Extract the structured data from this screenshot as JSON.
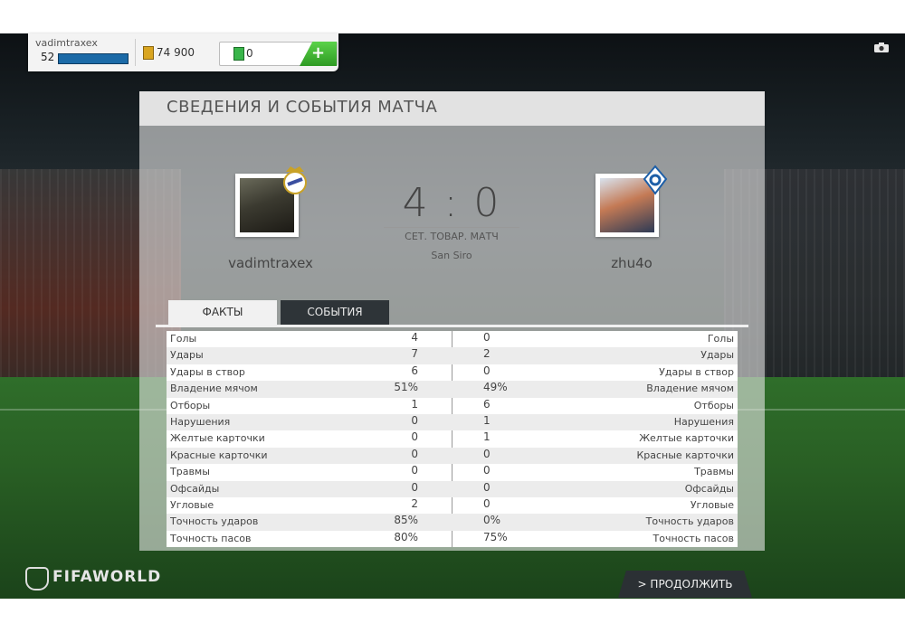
{
  "user": {
    "name": "vadimtraxex",
    "level": "52",
    "coins": "74 900",
    "points": "0",
    "add_label": "+"
  },
  "panel": {
    "title": "СВЕДЕНИЯ И СОБЫТИЯ МАТЧА"
  },
  "match": {
    "home_name": "vadimtraxex",
    "away_name": "zhu4o",
    "score": "4 : 0",
    "match_type": "СЕТ. ТОВАР. МАТЧ",
    "stadium": "San Siro"
  },
  "tabs": [
    {
      "label": "ФАКТЫ",
      "active": true
    },
    {
      "label": "СОБЫТИЯ",
      "active": false
    }
  ],
  "stats": [
    {
      "label": "Голы",
      "home": "4",
      "away": "0"
    },
    {
      "label": "Удары",
      "home": "7",
      "away": "2"
    },
    {
      "label": "Удары в створ",
      "home": "6",
      "away": "0"
    },
    {
      "label": "Владение мячом",
      "home": "51%",
      "away": "49%"
    },
    {
      "label": "Отборы",
      "home": "1",
      "away": "6"
    },
    {
      "label": "Нарушения",
      "home": "0",
      "away": "1"
    },
    {
      "label": "Желтые карточки",
      "home": "0",
      "away": "1"
    },
    {
      "label": "Красные карточки",
      "home": "0",
      "away": "0"
    },
    {
      "label": "Травмы",
      "home": "0",
      "away": "0"
    },
    {
      "label": "Офсайды",
      "home": "0",
      "away": "0"
    },
    {
      "label": "Угловые",
      "home": "2",
      "away": "0"
    },
    {
      "label": "Точность ударов",
      "home": "85%",
      "away": "0%"
    },
    {
      "label": "Точность пасов",
      "home": "80%",
      "away": "75%"
    }
  ],
  "footer": {
    "logo_text": "FIFAWORLD",
    "continue_label": "> ПРОДОЛЖИТЬ"
  },
  "icons": {
    "coins": "coins-icon",
    "points": "fifa-points-icon",
    "camera": "camera-icon",
    "home_badge": "real-madrid-crest-icon",
    "away_badge": "dynamo-crest-icon"
  },
  "colors": {
    "accent_green": "#39b54a",
    "xp_blue": "#1b6aa7",
    "tab_dark": "#2e3438"
  }
}
